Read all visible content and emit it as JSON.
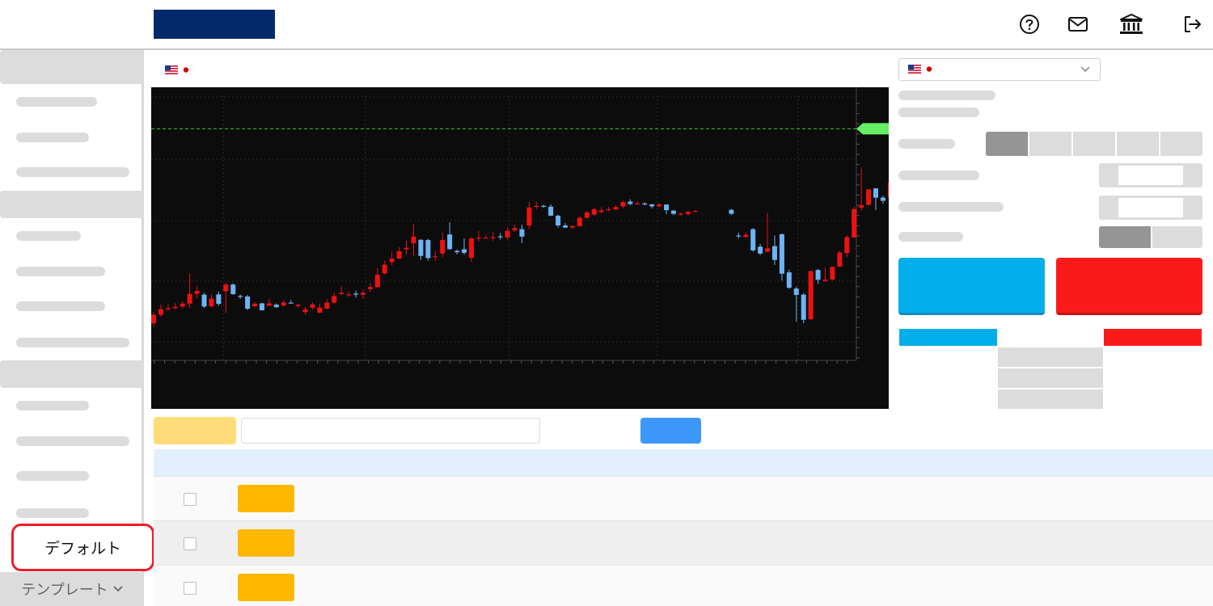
{
  "colors": {
    "brand": "#022a6b",
    "bull": "#ee1111",
    "bear": "#6cb4f5",
    "price_line": "#33cc33",
    "price_tag": "#66ee66",
    "buy": "#04aeea",
    "sell": "#fb1a1a",
    "badge": "#ffb800",
    "filter_yellow": "#ffdc7a",
    "filter_blue": "#3d97fb",
    "table_header": "#e3efff"
  },
  "header": {
    "icons": [
      "help-circle-icon",
      "mail-icon",
      "bank-icon",
      "logout-icon"
    ]
  },
  "sidebar": {
    "default_label": "デフォルト",
    "template_label": "テンプレート",
    "template_icon": "chevron-down-icon"
  },
  "pair": {
    "flags": [
      "us-flag-icon",
      "jp-flag-icon"
    ]
  },
  "chart_data": {
    "type": "candlestick",
    "candles": [
      [
        0.14,
        0.172,
        0.183,
        0.127
      ],
      [
        0.172,
        0.193,
        0.211,
        0.164
      ],
      [
        0.193,
        0.197,
        0.212,
        0.187
      ],
      [
        0.197,
        0.202,
        0.216,
        0.193
      ],
      [
        0.203,
        0.214,
        0.223,
        0.196
      ],
      [
        0.214,
        0.251,
        0.328,
        0.197
      ],
      [
        0.251,
        0.262,
        0.28,
        0.234
      ],
      [
        0.248,
        0.203,
        0.255,
        0.197
      ],
      [
        0.204,
        0.233,
        0.249,
        0.2
      ],
      [
        0.249,
        0.213,
        0.26,
        0.206
      ],
      [
        0.261,
        0.286,
        0.294,
        0.179
      ],
      [
        0.286,
        0.25,
        0.291,
        0.247
      ],
      [
        0.243,
        0.24,
        0.249,
        0.232
      ],
      [
        0.241,
        0.195,
        0.247,
        0.189
      ],
      [
        0.204,
        0.214,
        0.22,
        0.2
      ],
      [
        0.215,
        0.189,
        0.218,
        0.188
      ],
      [
        0.206,
        0.215,
        0.233,
        0.205
      ],
      [
        0.21,
        0.201,
        0.215,
        0.198
      ],
      [
        0.207,
        0.218,
        0.227,
        0.203
      ],
      [
        0.218,
        0.216,
        0.228,
        0.214
      ],
      [
        0.205,
        0.21,
        0.212,
        0.199
      ],
      [
        0.182,
        0.193,
        0.202,
        0.172
      ],
      [
        0.199,
        0.211,
        0.218,
        0.192
      ],
      [
        0.18,
        0.199,
        0.214,
        0.177
      ],
      [
        0.195,
        0.218,
        0.231,
        0.193
      ],
      [
        0.218,
        0.243,
        0.256,
        0.213
      ],
      [
        0.25,
        0.255,
        0.278,
        0.246
      ],
      [
        0.248,
        0.249,
        0.26,
        0.239
      ],
      [
        0.252,
        0.248,
        0.263,
        0.237
      ],
      [
        0.248,
        0.255,
        0.266,
        0.232
      ],
      [
        0.269,
        0.277,
        0.292,
        0.258
      ],
      [
        0.276,
        0.323,
        0.347,
        0.275
      ],
      [
        0.328,
        0.361,
        0.376,
        0.324
      ],
      [
        0.371,
        0.384,
        0.411,
        0.359
      ],
      [
        0.384,
        0.412,
        0.427,
        0.383
      ],
      [
        0.419,
        0.425,
        0.452,
        0.398
      ],
      [
        0.442,
        0.467,
        0.514,
        0.394
      ],
      [
        0.455,
        0.394,
        0.457,
        0.379
      ],
      [
        0.454,
        0.386,
        0.459,
        0.376
      ],
      [
        0.39,
        0.393,
        0.412,
        0.376
      ],
      [
        0.403,
        0.454,
        0.483,
        0.389
      ],
      [
        0.475,
        0.42,
        0.521,
        0.416
      ],
      [
        0.413,
        0.408,
        0.418,
        0.4
      ],
      [
        0.419,
        0.406,
        0.46,
        0.398
      ],
      [
        0.387,
        0.46,
        0.466,
        0.372
      ],
      [
        0.462,
        0.463,
        0.489,
        0.449
      ],
      [
        0.463,
        0.463,
        0.472,
        0.462
      ],
      [
        0.462,
        0.465,
        0.484,
        0.451
      ],
      [
        0.468,
        0.465,
        0.48,
        0.456
      ],
      [
        0.464,
        0.489,
        0.502,
        0.453
      ],
      [
        0.49,
        0.499,
        0.511,
        0.485
      ],
      [
        0.495,
        0.467,
        0.512,
        0.442
      ],
      [
        0.509,
        0.577,
        0.598,
        0.496
      ],
      [
        0.579,
        0.583,
        0.599,
        0.571
      ],
      [
        0.583,
        0.581,
        0.587,
        0.576
      ],
      [
        0.58,
        0.546,
        0.589,
        0.544
      ],
      [
        0.546,
        0.509,
        0.55,
        0.501
      ],
      [
        0.509,
        0.501,
        0.518,
        0.499
      ],
      [
        0.501,
        0.507,
        0.509,
        0.496
      ],
      [
        0.506,
        0.538,
        0.545,
        0.505
      ],
      [
        0.538,
        0.558,
        0.566,
        0.534
      ],
      [
        0.55,
        0.57,
        0.577,
        0.546
      ],
      [
        0.56,
        0.566,
        0.578,
        0.555
      ],
      [
        0.567,
        0.57,
        0.579,
        0.563
      ],
      [
        0.569,
        0.579,
        0.585,
        0.568
      ],
      [
        0.581,
        0.597,
        0.603,
        0.574
      ],
      [
        0.599,
        0.59,
        0.608,
        0.586
      ],
      [
        0.59,
        0.592,
        0.6,
        0.587
      ],
      [
        0.592,
        0.588,
        0.597,
        0.585
      ],
      [
        0.589,
        0.581,
        0.59,
        0.573
      ],
      [
        0.581,
        0.588,
        0.594,
        0.578
      ],
      [
        0.588,
        0.567,
        0.588,
        0.552
      ],
      [
        0.565,
        0.553,
        0.568,
        0.548
      ],
      [
        0.553,
        0.553,
        0.559,
        0.546
      ],
      [
        0.552,
        0.56,
        0.566,
        0.546
      ],
      [
        0.561,
        0.564,
        0.567,
        0.56
      ],
      [
        0.568,
        0.553,
        0.571,
        0.548
      ],
      [
        0.471,
        0.468,
        0.482,
        0.46
      ],
      [
        0.465,
        0.474,
        0.484,
        0.467
      ],
      [
        0.495,
        0.415,
        0.499,
        0.41
      ],
      [
        0.429,
        0.403,
        0.439,
        0.398
      ],
      [
        0.41,
        0.423,
        0.557,
        0.408
      ],
      [
        0.431,
        0.379,
        0.471,
        0.36
      ],
      [
        0.476,
        0.327,
        0.479,
        0.301
      ],
      [
        0.332,
        0.274,
        0.342,
        0.27
      ],
      [
        0.271,
        0.247,
        0.278,
        0.146
      ],
      [
        0.248,
        0.153,
        0.254,
        0.14
      ],
      [
        0.155,
        0.337,
        0.338,
        0.153
      ],
      [
        0.341,
        0.304,
        0.345,
        0.288
      ],
      [
        0.3,
        0.305,
        0.35,
        0.295
      ],
      [
        0.305,
        0.353,
        0.354,
        0.3
      ],
      [
        0.354,
        0.407,
        0.414,
        0.351
      ],
      [
        0.405,
        0.465,
        0.473,
        0.391
      ],
      [
        0.464,
        0.571,
        0.579,
        0.463
      ],
      [
        0.576,
        0.586,
        0.728,
        0.564
      ],
      [
        0.587,
        0.645,
        0.647,
        0.584
      ],
      [
        0.649,
        0.614,
        0.65,
        0.567
      ],
      [
        0.614,
        0.602,
        0.621,
        0.592
      ],
      [
        0.615,
        0.671,
        0.688,
        0.607
      ],
      [
        0.678,
        0.8,
        0.809,
        0.664
      ],
      [
        0.8,
        0.874,
        0.878,
        0.797
      ]
    ],
    "gap_after_index": 75,
    "price_line": 0.874,
    "grid": true
  }
}
